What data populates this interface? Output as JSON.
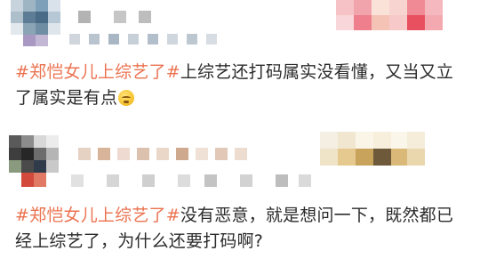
{
  "feed": {
    "posts": [
      {
        "author": "",
        "hashtag": "#郑恺女儿上综艺了#",
        "text": "上综艺还打码属实没看懂，又当又立了属实是有点",
        "emoji": "awkward-face-emoji"
      },
      {
        "author": "",
        "hashtag": "#郑恺女儿上综艺了#",
        "text": "没有恶意，就是想问一下，既然都已经上综艺了，为什么还要打码啊?"
      }
    ]
  },
  "colors": {
    "hashtag": "#eb7350",
    "body_text": "#2b2b2b",
    "background": "#ffffff"
  }
}
